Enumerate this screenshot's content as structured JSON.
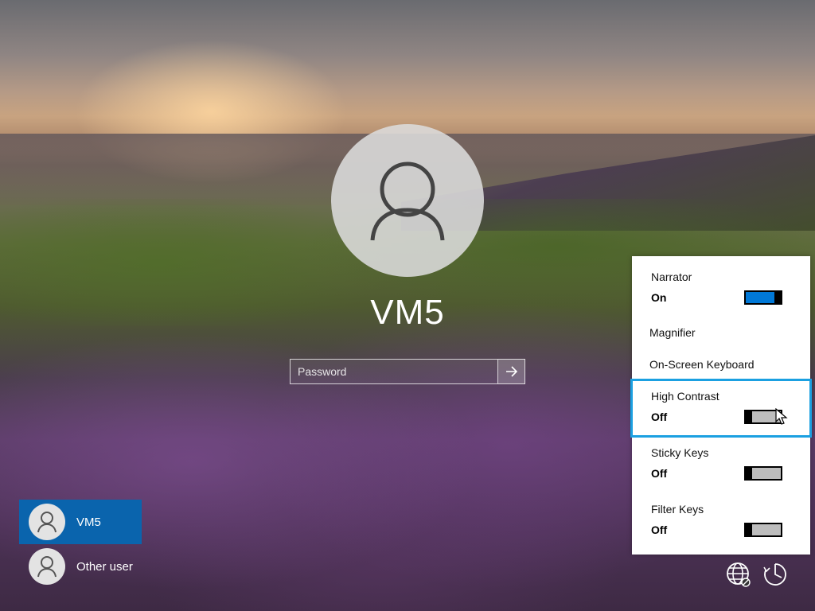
{
  "lock_screen": {
    "user_name": "VM5",
    "password_placeholder": "Password"
  },
  "user_list": [
    {
      "label": "VM5",
      "selected": true
    },
    {
      "label": "Other user",
      "selected": false
    }
  ],
  "ease_of_access": {
    "items": [
      {
        "title": "Narrator",
        "state": "On",
        "toggle_on": true
      },
      {
        "title": "Magnifier"
      },
      {
        "title": "On-Screen Keyboard"
      },
      {
        "title": "High Contrast",
        "state": "Off",
        "toggle_on": false,
        "focused": true
      },
      {
        "title": "Sticky Keys",
        "state": "Off",
        "toggle_on": false
      },
      {
        "title": "Filter Keys",
        "state": "Off",
        "toggle_on": false
      }
    ],
    "accent_color": "#0078d7",
    "focus_color": "#1ba0e1"
  },
  "bottom_icons": [
    "network-icon",
    "ease-of-access-icon"
  ]
}
